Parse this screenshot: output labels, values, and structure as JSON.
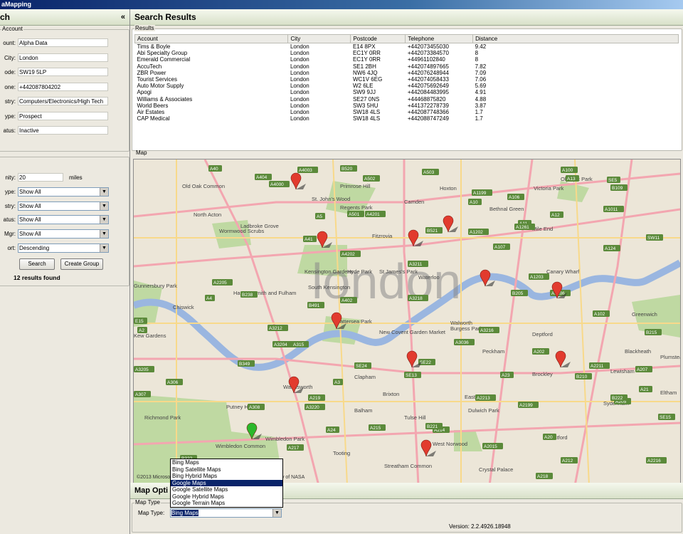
{
  "window": {
    "title": "aMapping"
  },
  "left_panel": {
    "header": "ch",
    "collapse_glyph": "«",
    "account_group": {
      "label": "Account",
      "fields": [
        {
          "label": "ount:",
          "value": "Alpha Data"
        },
        {
          "label": "City:",
          "value": "London"
        },
        {
          "label": "ode:",
          "value": "SW19 5LP"
        },
        {
          "label": "one:",
          "value": "+442087804202"
        },
        {
          "label": "stry:",
          "value": "Computers/Electronics/High Tech"
        },
        {
          "label": "ype:",
          "value": "Prospect"
        },
        {
          "label": "atus:",
          "value": "Inactive"
        }
      ]
    },
    "search_group": {
      "proximity_label": "nity:",
      "proximity_value": "20",
      "proximity_unit": "miles",
      "selects": [
        {
          "label": "ype:",
          "value": "Show All"
        },
        {
          "label": "stry:",
          "value": "Show All"
        },
        {
          "label": "atus:",
          "value": "Show All"
        },
        {
          "label": "Mgr:",
          "value": "Show All"
        },
        {
          "label": "ort:",
          "value": "Descending"
        }
      ],
      "search_button": "Search",
      "create_group_button": "Create Group",
      "results_count": "12 results found"
    }
  },
  "right_panel": {
    "header": "Search Results",
    "results_group_label": "Results",
    "columns": [
      "Account",
      "City",
      "Postcode",
      "Telephone",
      "Distance"
    ],
    "rows": [
      [
        "Tims & Boyle",
        "London",
        "E14 8PX",
        "+442073455030",
        "9.42"
      ],
      [
        "Abi Specialty Group",
        "London",
        "EC1Y 0RR",
        "+442073384570",
        "8"
      ],
      [
        "Emerald Commercial",
        "London",
        "EC1Y 0RR",
        "+44961102840",
        "8"
      ],
      [
        "AccuTech",
        "London",
        "SE1 2BH",
        "+442074897665",
        "7.82"
      ],
      [
        "ZBR Power",
        "London",
        "NW6 4JQ",
        "+442076248944",
        "7.09"
      ],
      [
        "Tourist Services",
        "London",
        "WC1V 6EG",
        "+442074058433",
        "7.06"
      ],
      [
        "Auto Motor Supply",
        "London",
        "W2 6LE",
        "+442075692649",
        "5.69"
      ],
      [
        "Apogi",
        "London",
        "SW9 9JJ",
        "+442084483995",
        "4.91"
      ],
      [
        "Williams & Associates",
        "London",
        "SE27 0NS",
        "+44468875820",
        "4.88"
      ],
      [
        "World Beers",
        "London",
        "SW3 5HU",
        "+441372278739",
        "3.87"
      ],
      [
        "Air Estates",
        "London",
        "SW18 4LS",
        "+442087748366",
        "1.7"
      ],
      [
        "CAP Medical",
        "London",
        "SW18 4LS",
        "+442088747249",
        "1.7"
      ]
    ],
    "map_group_label": "Map",
    "map": {
      "city_label": "london",
      "copyright": "©2013 Microsoft",
      "copyright_right": "ty of NASA",
      "places": [
        "Old Oak Common",
        "North Acton",
        "Ladbroke Grove",
        "Wormwood Scrubs",
        "St. John's Wood",
        "Regents Park",
        "Primrose Hill",
        "Fitzrovia",
        "Camden",
        "Hoxton",
        "Victoria Park",
        "Olympic Park",
        "Bethnal Green",
        "Mile End",
        "Kensington Gardens",
        "Hyde Park",
        "St James's Park",
        "South Kensington",
        "Waterloo",
        "Hammersmith and Fulham",
        "Chiswick",
        "Gunnersbury Park",
        "Kew Gardens",
        "Battersea Park",
        "New Covent Garden Market",
        "Walworth",
        "Burgess Park",
        "Peckham",
        "Canary Wharf",
        "Deptford",
        "Greenwich",
        "Blackheath",
        "Brockley",
        "East Dulwich",
        "Clapham",
        "Wandsworth",
        "Putney Heath",
        "Richmond Park",
        "Wimbledon Park",
        "Wimbledon Common",
        "Tooting",
        "Balham",
        "Brixton",
        "Tulse Hill",
        "Streatham Common",
        "West Norwood",
        "Crystal Palace",
        "Dulwich Park",
        "Sydenham",
        "Catford",
        "Lewisham",
        "Eltham",
        "Plumstead"
      ],
      "roads": [
        "A40",
        "A5",
        "A41",
        "A404",
        "A4000",
        "A4003",
        "B520",
        "A502",
        "A503",
        "A1199",
        "A10",
        "A106",
        "A12",
        "A11",
        "A13",
        "A1261",
        "A1202",
        "A107",
        "B109",
        "A100",
        "A1011",
        "A124",
        "A501",
        "A4201",
        "A4202",
        "B521",
        "A3211",
        "A1203",
        "B205",
        "A1206",
        "A102",
        "A3",
        "A23",
        "A4",
        "A315",
        "A3220",
        "A3212",
        "A3204",
        "A2",
        "A202",
        "A205",
        "A20",
        "A2213",
        "A212",
        "A21",
        "A24",
        "A214",
        "A217",
        "A218",
        "A2015",
        "A2216",
        "A2212",
        "A3205",
        "A306",
        "B349",
        "A307",
        "B322",
        "A308",
        "A219",
        "A215",
        "B221",
        "A2199",
        "A2205",
        "B238",
        "B491",
        "A402",
        "A3218",
        "A3216",
        "A3036",
        "B215",
        "B222",
        "B210",
        "A2211",
        "A207",
        "SE15",
        "SE13",
        "SE22",
        "SE24",
        "SE5",
        "SW11",
        "E15",
        "A114",
        "A206"
      ],
      "pins": [
        {
          "color": "#e23b2e"
        },
        {
          "color": "#e23b2e"
        },
        {
          "color": "#e23b2e"
        },
        {
          "color": "#e23b2e"
        },
        {
          "color": "#e23b2e"
        },
        {
          "color": "#e23b2e"
        },
        {
          "color": "#e23b2e"
        },
        {
          "color": "#e23b2e"
        },
        {
          "color": "#e23b2e"
        },
        {
          "color": "#e23b2e"
        },
        {
          "color": "#e23b2e"
        },
        {
          "color": "#2bb82b"
        }
      ]
    },
    "options_header": "Map Opti",
    "map_type_group_label": "Map Type",
    "map_type_label": "Map Type:",
    "map_type_value": "Bing Maps",
    "map_type_options": [
      "Bing Maps",
      "Bing Satellite Maps",
      "Bing Hybrid Maps",
      "Google Maps",
      "Google Satellite Maps",
      "Google Hybrid Maps",
      "Google Terrain Maps"
    ],
    "map_type_highlighted": "Google Maps",
    "version": "Version: 2.2.4926.18948"
  }
}
